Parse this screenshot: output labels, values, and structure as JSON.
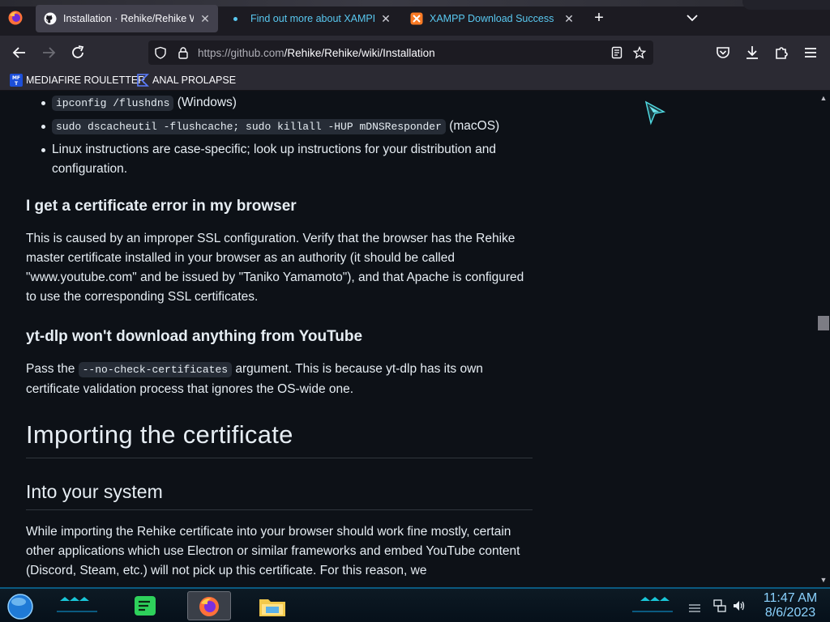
{
  "tabs": [
    {
      "title": "Installation · Rehike/Rehike Wiki",
      "icon": "github-icon",
      "active": true
    },
    {
      "title": "Find out more about XAMPP | S",
      "icon": "dot-indicator",
      "active": false
    },
    {
      "title": "XAMPP Download Success",
      "icon": "xampp-icon",
      "active": false
    }
  ],
  "url": {
    "host": "https://github.com",
    "path": "/Rehike/Rehike/wiki/Installation"
  },
  "bookmarks": [
    {
      "label": "MEDIAFIRE ROULETTER",
      "icon": "mediafire-icon"
    },
    {
      "label": "ANAL PROLAPSE",
      "icon": "bookmark-icon"
    }
  ],
  "content": {
    "bullets": [
      {
        "code": "ipconfig /flushdns",
        "text": " (Windows)"
      },
      {
        "code": "sudo dscacheutil -flushcache; sudo killall -HUP mDNSResponder",
        "text": " (macOS)"
      },
      {
        "code": "",
        "text": "Linux instructions are case-specific; look up instructions for your distribution and configuration."
      }
    ],
    "cert_heading": "I get a certificate error in my browser",
    "cert_paragraph": "This is caused by an improper SSL configuration. Verify that the browser has the Rehike master certificate installed in your browser as an authority (it should be called \"www.youtube.com\" and be issued by \"Taniko Yamamoto\"), and that Apache is configured to use the corresponding SSL certificates.",
    "ytdlp_heading": "yt-dlp won't download anything from YouTube",
    "ytdlp_pre": "Pass the ",
    "ytdlp_code": "--no-check-certificates",
    "ytdlp_post": " argument. This is because yt-dlp has its own certificate validation process that ignores the OS-wide one.",
    "import_heading": "Importing the certificate",
    "system_heading": "Into your system",
    "system_paragraph": "While importing the Rehike certificate into your browser should work fine mostly, certain other applications which use Electron or similar frameworks and embed YouTube content (Discord, Steam, etc.) will not pick up this certificate. For this reason, we"
  },
  "taskbar": {
    "apps": [
      {
        "name": "spotify-like-app",
        "running": false
      },
      {
        "name": "firefox",
        "running": true
      },
      {
        "name": "file-explorer",
        "running": false
      }
    ],
    "time": "11:47 AM",
    "date": "8/6/2023"
  },
  "colors": {
    "accent": "#59c8f0",
    "page_bg": "#0d1117",
    "clock": "#8bd3ff"
  }
}
